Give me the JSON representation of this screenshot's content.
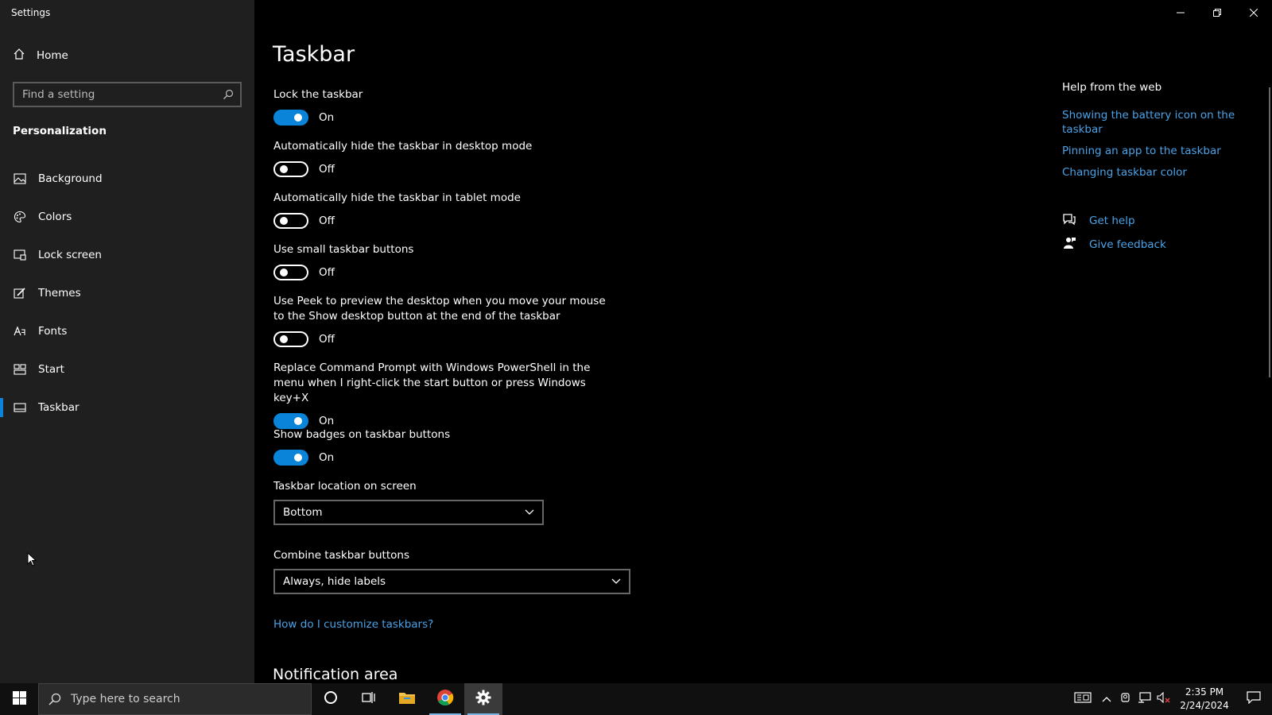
{
  "window": {
    "title": "Settings"
  },
  "sidebar": {
    "home_label": "Home",
    "search_placeholder": "Find a setting",
    "section_title": "Personalization",
    "items": [
      {
        "label": "Background",
        "icon": "image-icon"
      },
      {
        "label": "Colors",
        "icon": "palette-icon"
      },
      {
        "label": "Lock screen",
        "icon": "lock-screen-icon"
      },
      {
        "label": "Themes",
        "icon": "brush-icon"
      },
      {
        "label": "Fonts",
        "icon": "font-icon"
      },
      {
        "label": "Start",
        "icon": "start-tiles-icon"
      },
      {
        "label": "Taskbar",
        "icon": "taskbar-icon",
        "active": true
      }
    ]
  },
  "main": {
    "title": "Taskbar",
    "settings": [
      {
        "label": "Lock the taskbar",
        "state": "On"
      },
      {
        "label": "Automatically hide the taskbar in desktop mode",
        "state": "Off"
      },
      {
        "label": "Automatically hide the taskbar in tablet mode",
        "state": "Off"
      },
      {
        "label": "Use small taskbar buttons",
        "state": "Off"
      },
      {
        "label": "Use Peek to preview the desktop when you move your mouse to the Show desktop button at the end of the taskbar",
        "state": "Off"
      },
      {
        "label": "Replace Command Prompt with Windows PowerShell in the menu when I right-click the start button or press Windows key+X",
        "state": "On"
      },
      {
        "label": "Show badges on taskbar buttons",
        "state": "On"
      }
    ],
    "location_label": "Taskbar location on screen",
    "location_value": "Bottom",
    "combine_label": "Combine taskbar buttons",
    "combine_value": "Always, hide labels",
    "customize_link": "How do I customize taskbars?",
    "notification_heading": "Notification area"
  },
  "help": {
    "title": "Help from the web",
    "links": [
      "Showing the battery icon on the taskbar",
      "Pinning an app to the taskbar",
      "Changing taskbar color"
    ],
    "get_help": "Get help",
    "give_feedback": "Give feedback"
  },
  "taskbar": {
    "search_placeholder": "Type here to search",
    "time": "2:35 PM",
    "date": "2/24/2024"
  },
  "colors": {
    "accent": "#0a84d9",
    "link": "#4aa3e8",
    "sidebar_bg": "#1f1f1f"
  }
}
